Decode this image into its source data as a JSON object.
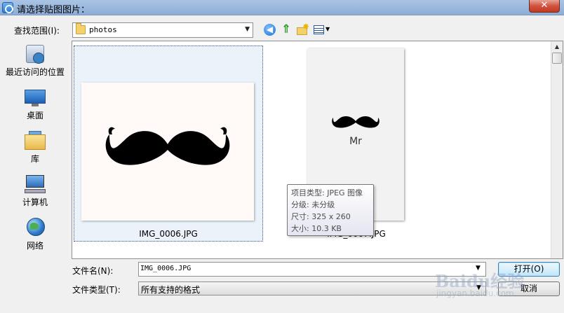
{
  "window": {
    "title": "请选择贴图图片：",
    "close_glyph": "✕"
  },
  "toolbar": {
    "look_in_label": "查找范围(I):",
    "look_in_value": "photos",
    "back_glyph": "◀",
    "up_glyph": "⇑",
    "new_folder_glyph": "✸",
    "dropdown_glyph": "▼"
  },
  "places": [
    {
      "label": "最近访问的位置",
      "icon": "recent-places-icon"
    },
    {
      "label": "桌面",
      "icon": "desktop-icon"
    },
    {
      "label": "库",
      "icon": "libraries-icon"
    },
    {
      "label": "计算机",
      "icon": "computer-icon"
    },
    {
      "label": "网络",
      "icon": "network-icon"
    }
  ],
  "files": [
    {
      "name": "IMG_0006.JPG",
      "selected": true
    },
    {
      "name": "IMG_0007.JPG",
      "selected": false,
      "thumb_text": "Mr"
    }
  ],
  "tooltip": {
    "type": "项目类型: JPEG 图像",
    "rating": "分级: 未分级",
    "dimensions": "尺寸: 325 x 260",
    "size": "大小: 10.3 KB"
  },
  "footer": {
    "filename_label": "文件名(N):",
    "filename_value": "IMG_0006.JPG",
    "filetype_label": "文件类型(T):",
    "filetype_value": "所有支持的格式",
    "open_label": "打开(O)",
    "cancel_label": "取消"
  },
  "watermark": {
    "main": "Baidu经验",
    "sub": "jingyan.baidu.com"
  },
  "colors": {
    "selection": "#ebf2fa",
    "selection_border": "#2a4c86",
    "titlebar": "#98b6dc",
    "close": "#d0533f"
  }
}
